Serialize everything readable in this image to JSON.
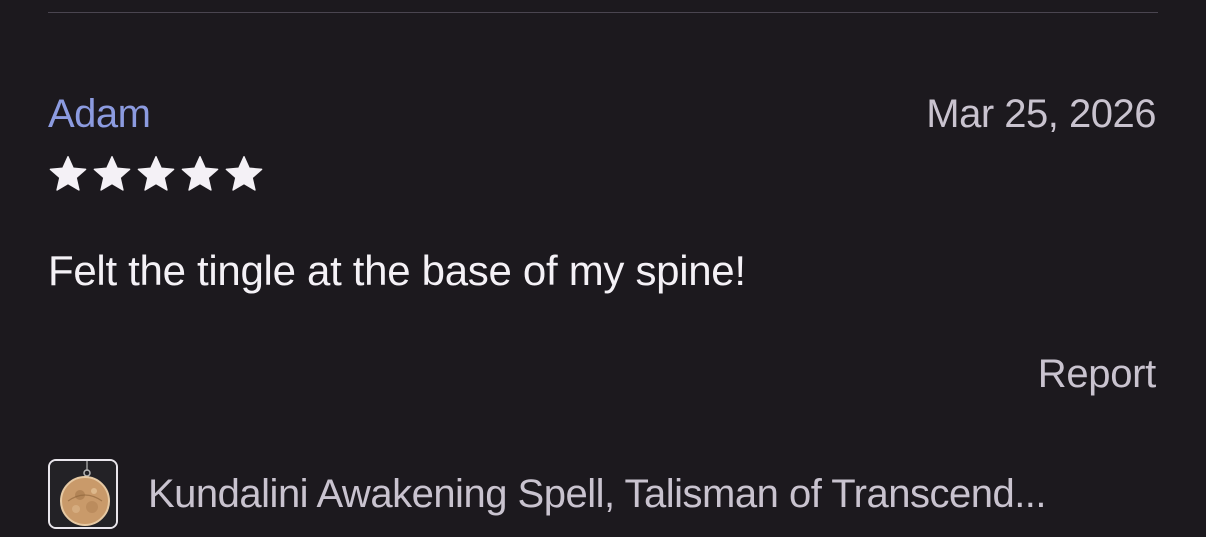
{
  "review": {
    "reviewer_name": "Adam",
    "date": "Mar 25, 2026",
    "rating": 5,
    "rating_max": 5,
    "text": "Felt the tingle at the base of my spine!",
    "report_label": "Report"
  },
  "product": {
    "title": "Kundalini Awakening Spell, Talisman of Transcend...",
    "thumbnail_icon": "pendant-thumbnail"
  },
  "colors": {
    "background": "#1c191e",
    "reviewer_name": "#8c9be0",
    "muted_text": "#c9c3cf",
    "primary_text": "#f4f1f6",
    "star": "#f4f1f6"
  }
}
